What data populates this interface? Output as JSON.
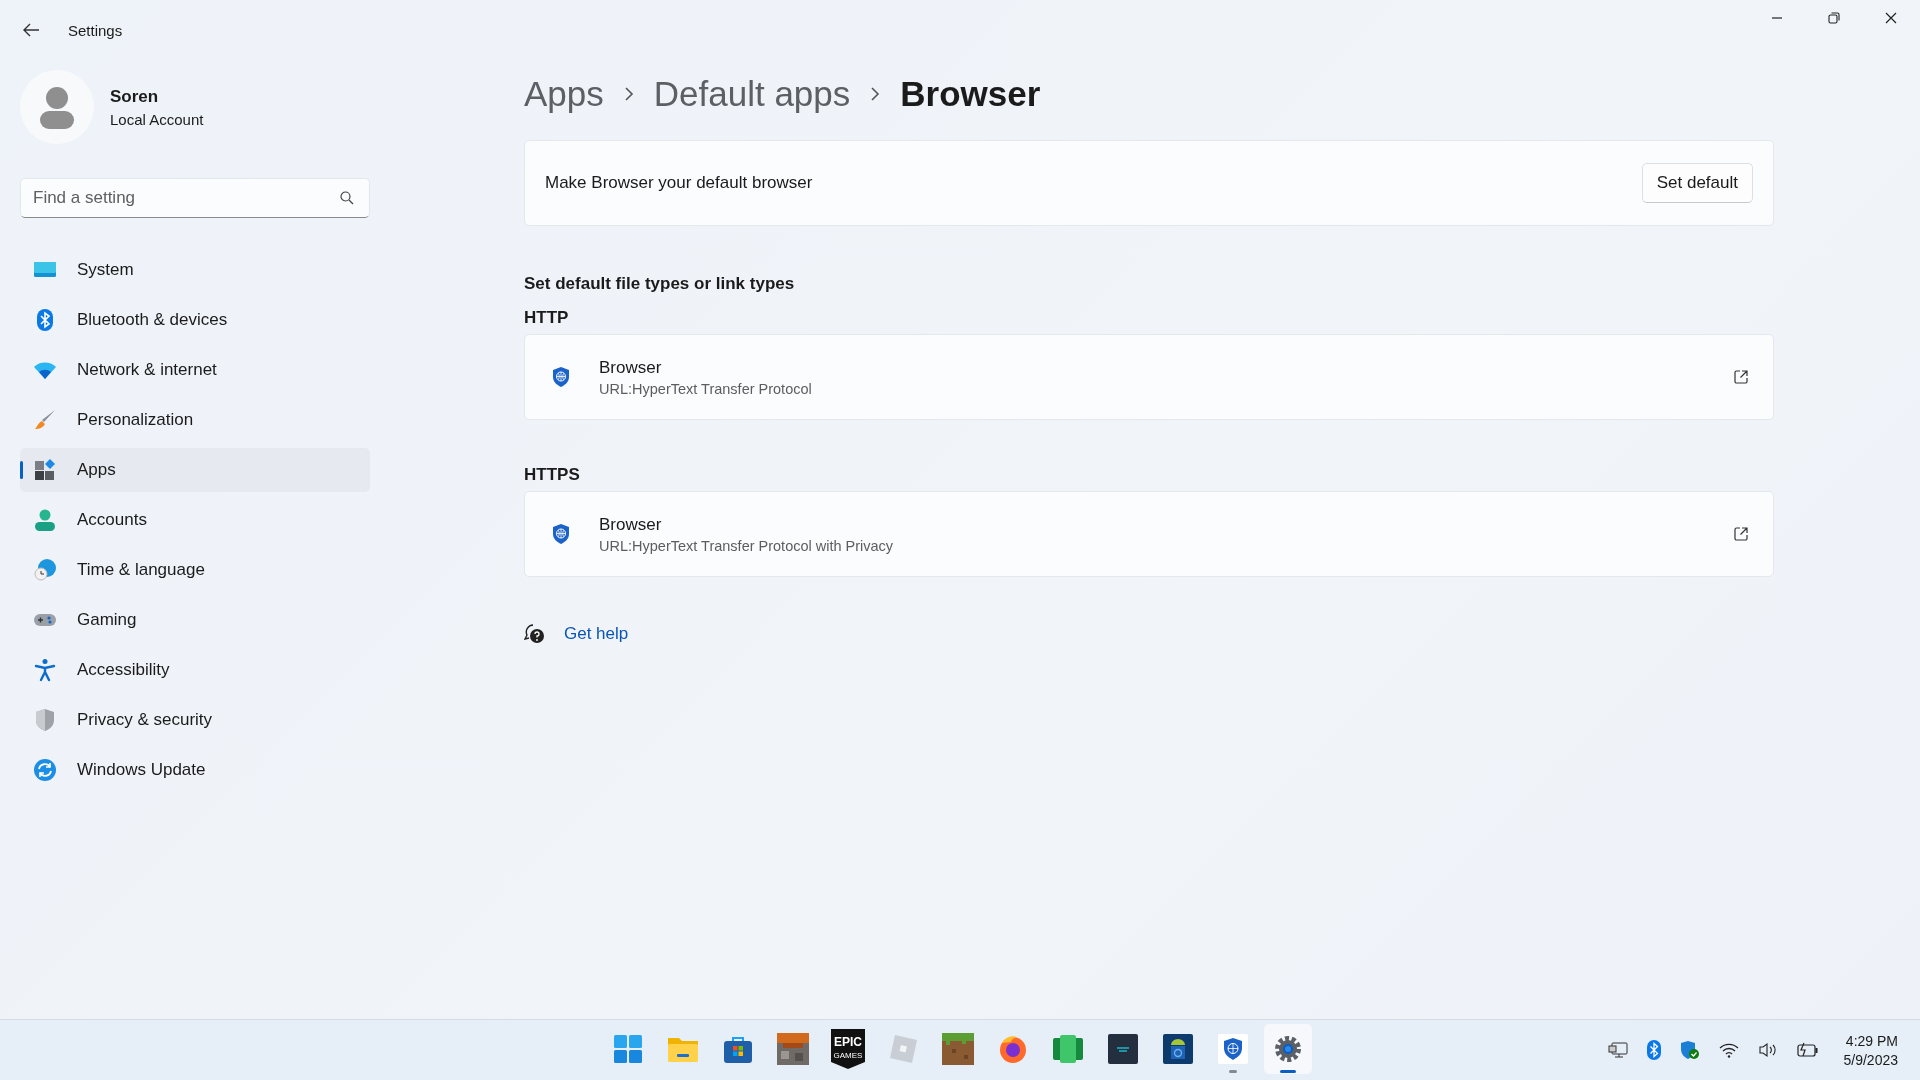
{
  "window": {
    "title": "Settings"
  },
  "user": {
    "name": "Soren",
    "account": "Local Account"
  },
  "search": {
    "placeholder": "Find a setting"
  },
  "nav": [
    {
      "kind": "system",
      "label": "System",
      "selected": false
    },
    {
      "kind": "bluetooth",
      "label": "Bluetooth & devices",
      "selected": false
    },
    {
      "kind": "network",
      "label": "Network & internet",
      "selected": false
    },
    {
      "kind": "personalization",
      "label": "Personalization",
      "selected": false
    },
    {
      "kind": "apps",
      "label": "Apps",
      "selected": true
    },
    {
      "kind": "accounts",
      "label": "Accounts",
      "selected": false
    },
    {
      "kind": "time",
      "label": "Time & language",
      "selected": false
    },
    {
      "kind": "gaming",
      "label": "Gaming",
      "selected": false
    },
    {
      "kind": "accessibility",
      "label": "Accessibility",
      "selected": false
    },
    {
      "kind": "privacy",
      "label": "Privacy & security",
      "selected": false
    },
    {
      "kind": "update",
      "label": "Windows Update",
      "selected": false
    }
  ],
  "breadcrumb": [
    "Apps",
    "Default apps",
    "Browser"
  ],
  "default_card": {
    "text": "Make Browser your default browser",
    "button": "Set default"
  },
  "section_title": "Set default file types or link types",
  "associations": [
    {
      "type": "HTTP",
      "app": "Browser",
      "description": "URL:HyperText Transfer Protocol"
    },
    {
      "type": "HTTPS",
      "app": "Browser",
      "description": "URL:HyperText Transfer Protocol with Privacy"
    }
  ],
  "help": {
    "label": "Get help"
  },
  "taskbar": {
    "apps": [
      {
        "kind": "start",
        "running": false,
        "selected": false
      },
      {
        "kind": "explorer",
        "running": false,
        "selected": false
      },
      {
        "kind": "store",
        "running": false,
        "selected": false
      },
      {
        "kind": "dungeons",
        "running": false,
        "selected": false
      },
      {
        "kind": "epic",
        "label": "EPIC",
        "sublabel": "GAMES",
        "running": false,
        "selected": false
      },
      {
        "kind": "roblox",
        "running": false,
        "selected": false
      },
      {
        "kind": "minecraft",
        "running": false,
        "selected": false
      },
      {
        "kind": "firefox",
        "running": false,
        "selected": false
      },
      {
        "kind": "green",
        "running": false,
        "selected": false
      },
      {
        "kind": "appstore",
        "running": false,
        "selected": false
      },
      {
        "kind": "android",
        "running": false,
        "selected": false
      },
      {
        "kind": "browser",
        "running": true,
        "selected": false
      },
      {
        "kind": "settings",
        "running": true,
        "selected": true
      }
    ],
    "clock": {
      "time": "4:29 PM",
      "date": "5/9/2023"
    }
  }
}
